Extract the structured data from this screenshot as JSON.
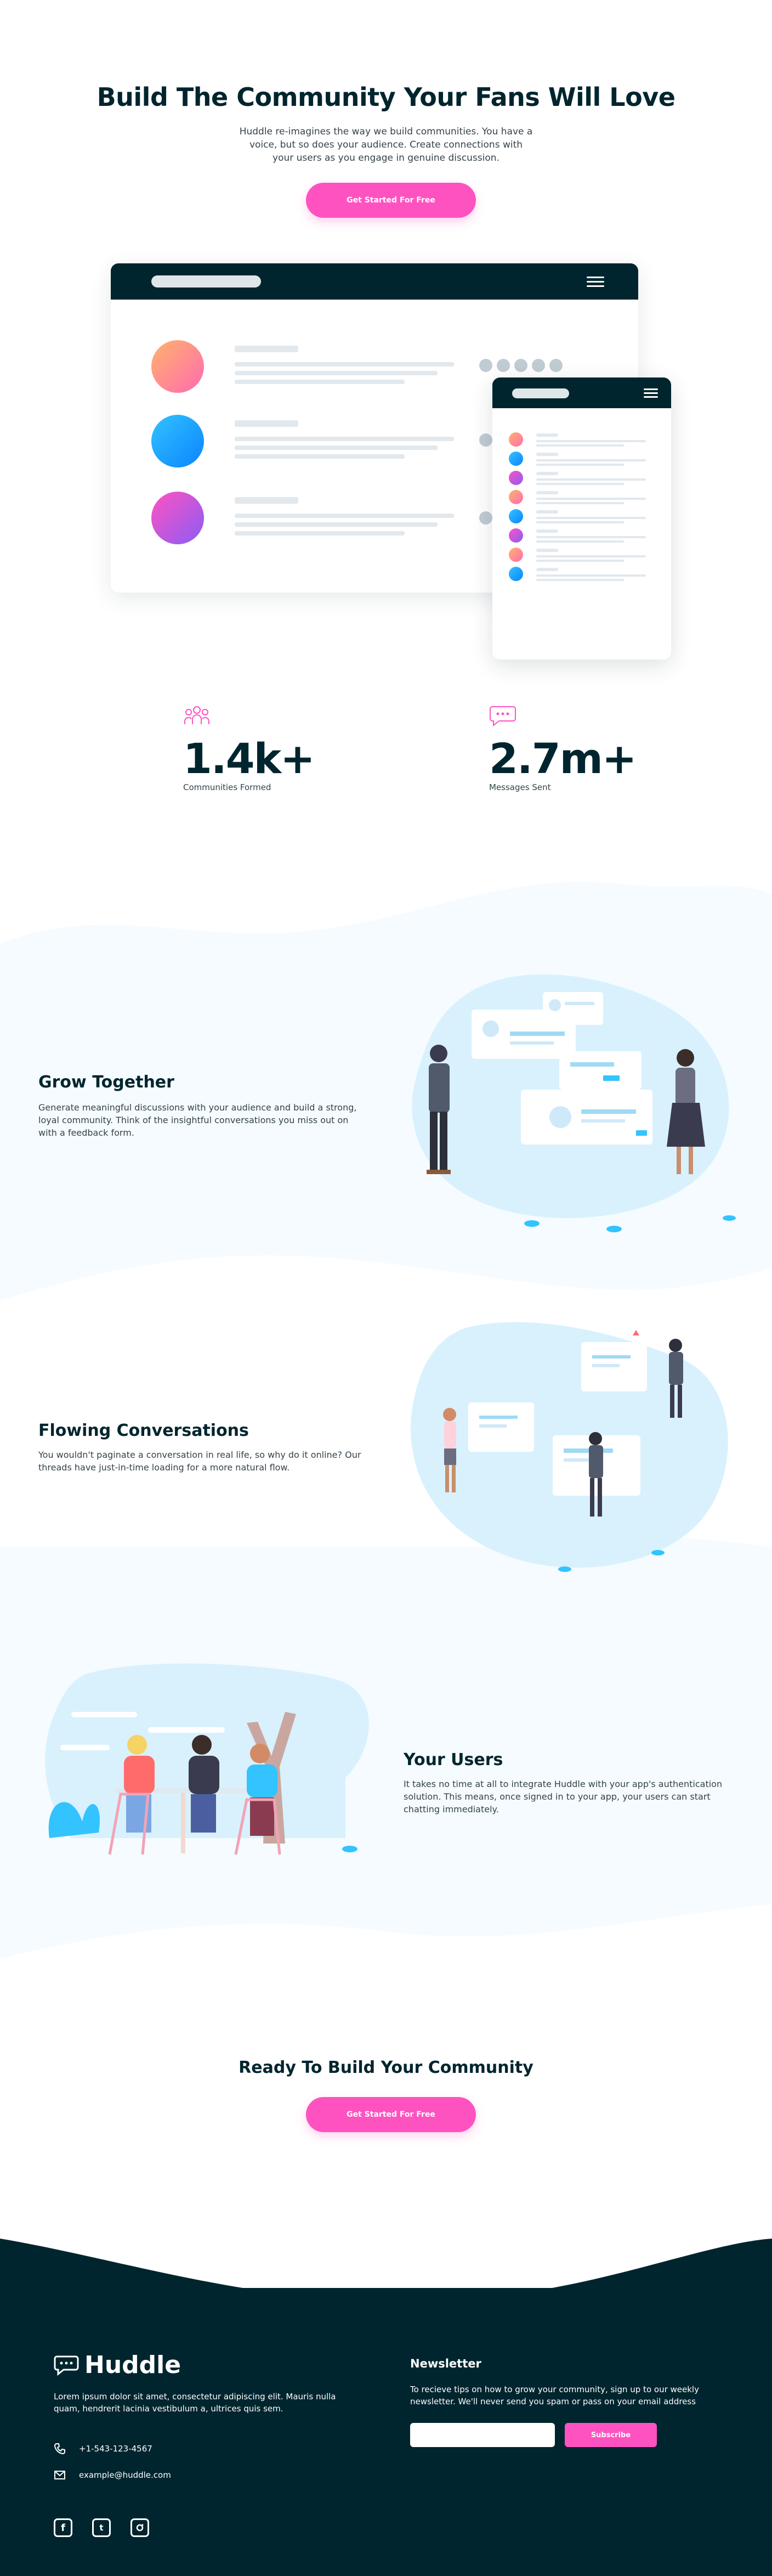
{
  "hero": {
    "title": "Build The Community Your Fans Will Love",
    "subtitle": "Huddle re-imagines the way we build communities. You have a voice, but so does your audience. Create connections with your users as you engage in genuine discussion.",
    "cta_label": "Get Started For Free"
  },
  "stats": [
    {
      "value": "1.4k+",
      "label": "Communities Formed",
      "icon": "communities-icon"
    },
    {
      "value": "2.7m+",
      "label": "Messages Sent",
      "icon": "messages-icon"
    }
  ],
  "features": [
    {
      "title": "Grow Together",
      "body": "Generate meaningful discussions with your audience and build a strong, loyal community. Think of the insightful conversations you miss out on with a feedback form."
    },
    {
      "title": "Flowing Conversations",
      "body": "You wouldn't paginate a conversation in real life, so why do it online? Our threads have just-in-time loading for a more natural flow."
    },
    {
      "title": "Your Users",
      "body": "It takes no time at all to integrate Huddle with your app's authentication solution. This means, once signed in to your app, your users can start chatting immediately."
    }
  ],
  "ready": {
    "title": "Ready To Build Your Community",
    "cta_label": "Get Started For Free"
  },
  "footer": {
    "logo": "Huddle",
    "description": "Lorem ipsum dolor sit amet, consectetur adipiscing elit. Mauris nulla quam, hendrerit lacinia vestibulum a, ultrices quis sem.",
    "phone": "+1-543-123-4567",
    "email": "example@huddle.com",
    "newsletter_title": "Newsletter",
    "newsletter_text": "To recieve tips on how to grow your community, sign up to our weekly newsletter. We'll never send you spam or pass on your email address",
    "subscribe_label": "Subscribe",
    "socials": [
      "facebook-icon",
      "twitter-icon",
      "instagram-icon"
    ]
  },
  "colors": {
    "accent": "#ff52c1",
    "dark": "#00252e",
    "wave": "#f5fbff"
  }
}
